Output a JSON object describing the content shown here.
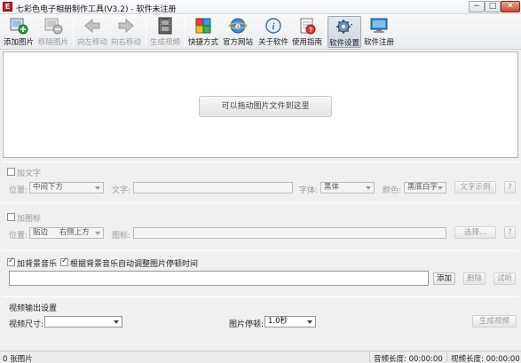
{
  "window": {
    "title": "七彩色电子相册制作工具(V3.2) - 软件未注册",
    "icon_name": "app-logo-icon",
    "minimize_glyph": "−",
    "maximize_glyph": "□",
    "close_glyph": "✕"
  },
  "toolbar": {
    "add_image": "添加图片",
    "remove_image": "移除图片",
    "move_left": "向左移动",
    "move_right": "向右移动",
    "generate_video": "生成视频",
    "shortcut": "快捷方式",
    "official_site": "官方网站",
    "about": "关于软件",
    "guide": "使用指南",
    "settings": "软件设置",
    "register": "软件注册"
  },
  "dropzone": {
    "hint": "可以拖动图片文件到这里"
  },
  "text_section": {
    "checkbox_label": "加文字",
    "position_label": "位置:",
    "position_value": "中间下方",
    "text_label": "文字:",
    "font_label": "字体:",
    "font_value": "黑体",
    "color_label": "颜色:",
    "color_value": "黑底白字",
    "preview_button": "文字示例",
    "help_button": "?"
  },
  "logo_section": {
    "checkbox_label": "加图标",
    "position_label": "位置:",
    "position_value_1": "贴边",
    "position_value_2": "右侧上方",
    "icon_label": "图标:",
    "choose_button": "选择...",
    "help_button": "?"
  },
  "music_section": {
    "add_music_label": "加背景音乐",
    "auto_adjust_label": "根据背景音乐自动调整图片停顿时间",
    "add_button": "添加",
    "delete_button": "删除",
    "listen_button": "试听"
  },
  "video_section": {
    "heading": "视频输出设置",
    "size_label": "视频尺寸:",
    "size_value": "",
    "pause_label": "图片停顿:",
    "pause_value": "1.0秒",
    "generate_button": "生成视频"
  },
  "statusbar": {
    "image_count": "0 张图片",
    "audio_length": "音频长度: 00:00:00",
    "video_length": "视频长度: 00:00:00"
  }
}
